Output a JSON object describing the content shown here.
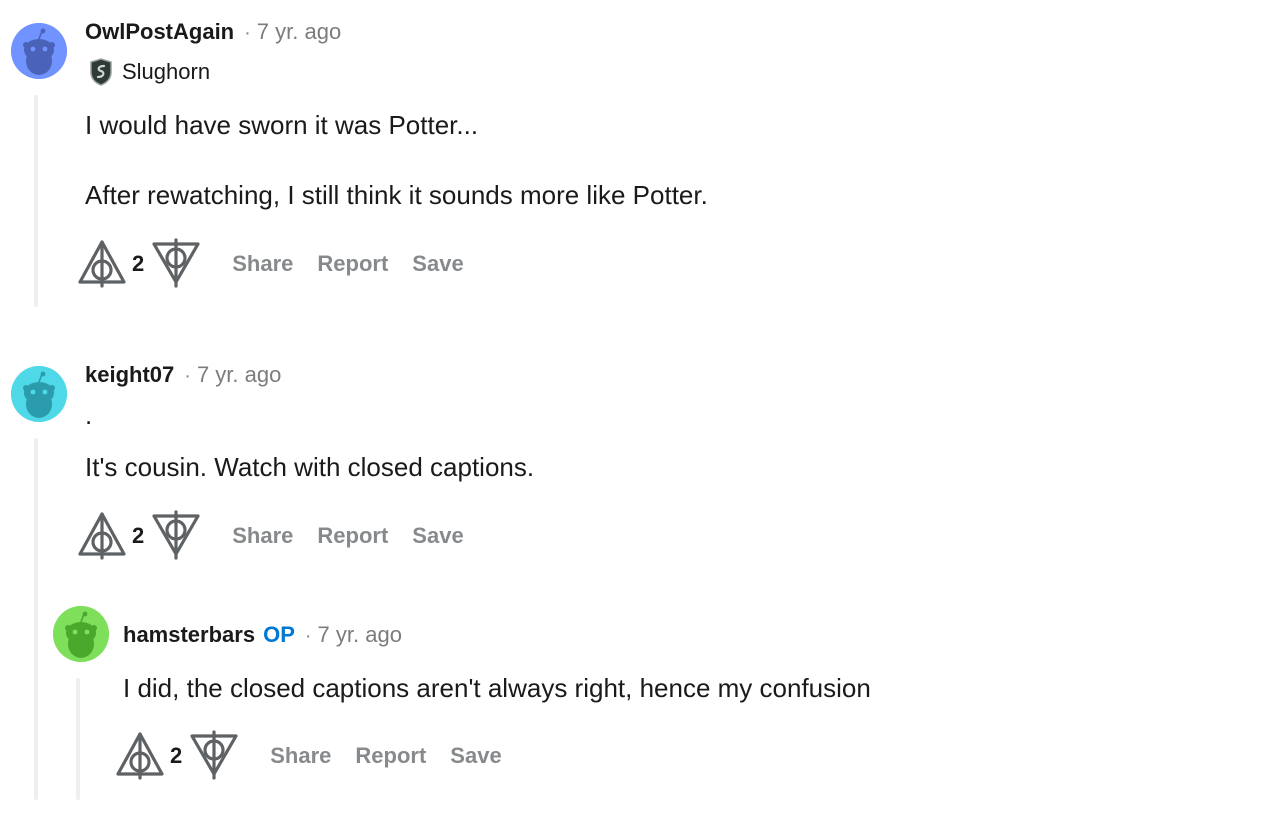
{
  "comments": [
    {
      "author": "OwlPostAgain",
      "time": "7 yr. ago",
      "flair": "Slughorn",
      "body": [
        "I would have sworn it was Potter...",
        "After rewatching, I still think it sounds more like Potter."
      ],
      "score": "2",
      "avatar_color": "#7193ff",
      "actions": {
        "share": "Share",
        "report": "Report",
        "save": "Save"
      }
    },
    {
      "author": "keight07",
      "time": "7 yr. ago",
      "body": [
        ".",
        "It's cousin. Watch with closed captions."
      ],
      "score": "2",
      "avatar_color": "#4fd8e8",
      "actions": {
        "share": "Share",
        "report": "Report",
        "save": "Save"
      }
    },
    {
      "author": "hamsterbars",
      "op_badge": "OP",
      "time": "7 yr. ago",
      "body": [
        "I did, the closed captions aren't always right, hence my confusion"
      ],
      "score": "2",
      "avatar_color": "#7ee05a",
      "actions": {
        "share": "Share",
        "report": "Report",
        "save": "Save"
      }
    }
  ],
  "meta_separator": "·",
  "icons": {
    "upvote": "deathly-hallows-upvote-icon",
    "downvote": "deathly-hallows-downvote-icon",
    "flair": "slytherin-crest-icon"
  },
  "colors": {
    "op": "#0079d3",
    "muted": "#878a8c",
    "thread_line": "#edeff1"
  }
}
